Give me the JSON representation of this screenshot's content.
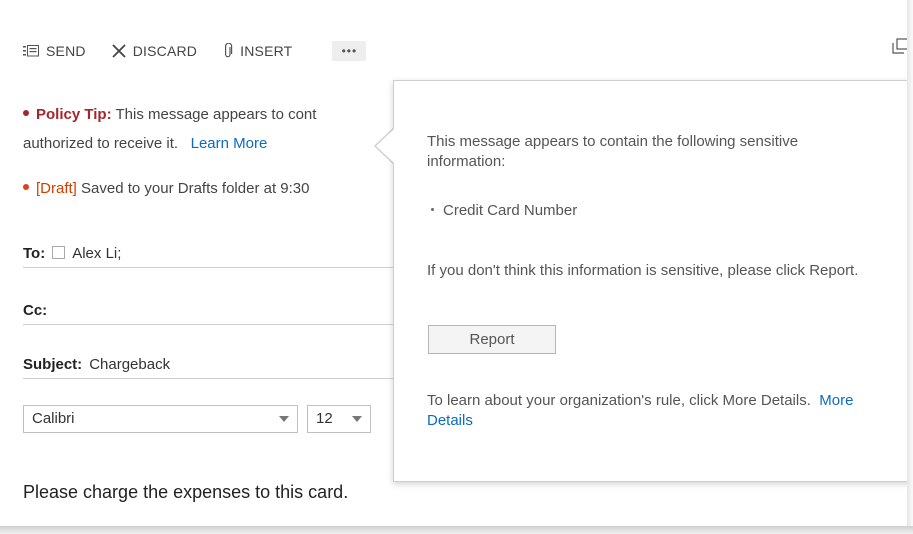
{
  "toolbar": {
    "send_label": "SEND",
    "discard_label": "DISCARD",
    "insert_label": "INSERT",
    "more_label": "•••"
  },
  "policy_tip": {
    "label": "Policy Tip:",
    "text": "This message appears to cont",
    "line2": "authorized to receive it.",
    "learn_more": "Learn More"
  },
  "draft": {
    "label": "[Draft]",
    "text": "Saved to your Drafts folder at 9:30"
  },
  "fields": {
    "to_label": "To:",
    "to_value": "Alex Li;",
    "cc_label": "Cc:",
    "subject_label": "Subject:",
    "subject_value": "Chargeback"
  },
  "format": {
    "font": "Calibri",
    "size": "12"
  },
  "body": {
    "text": "Please charge the expenses to this card."
  },
  "popup": {
    "intro": "This message appears to contain the following sensitive information:",
    "items": [
      "Credit Card Number"
    ],
    "desc": "If you don't think this information is sensitive, please click Report.",
    "report_label": "Report",
    "rule": "To learn about your organization's rule, click More Details.",
    "more_details": "More Details"
  },
  "colors": {
    "policy_red": "#a4262c",
    "draft_orange": "#d83b01",
    "link_blue": "#0a6cc2"
  }
}
